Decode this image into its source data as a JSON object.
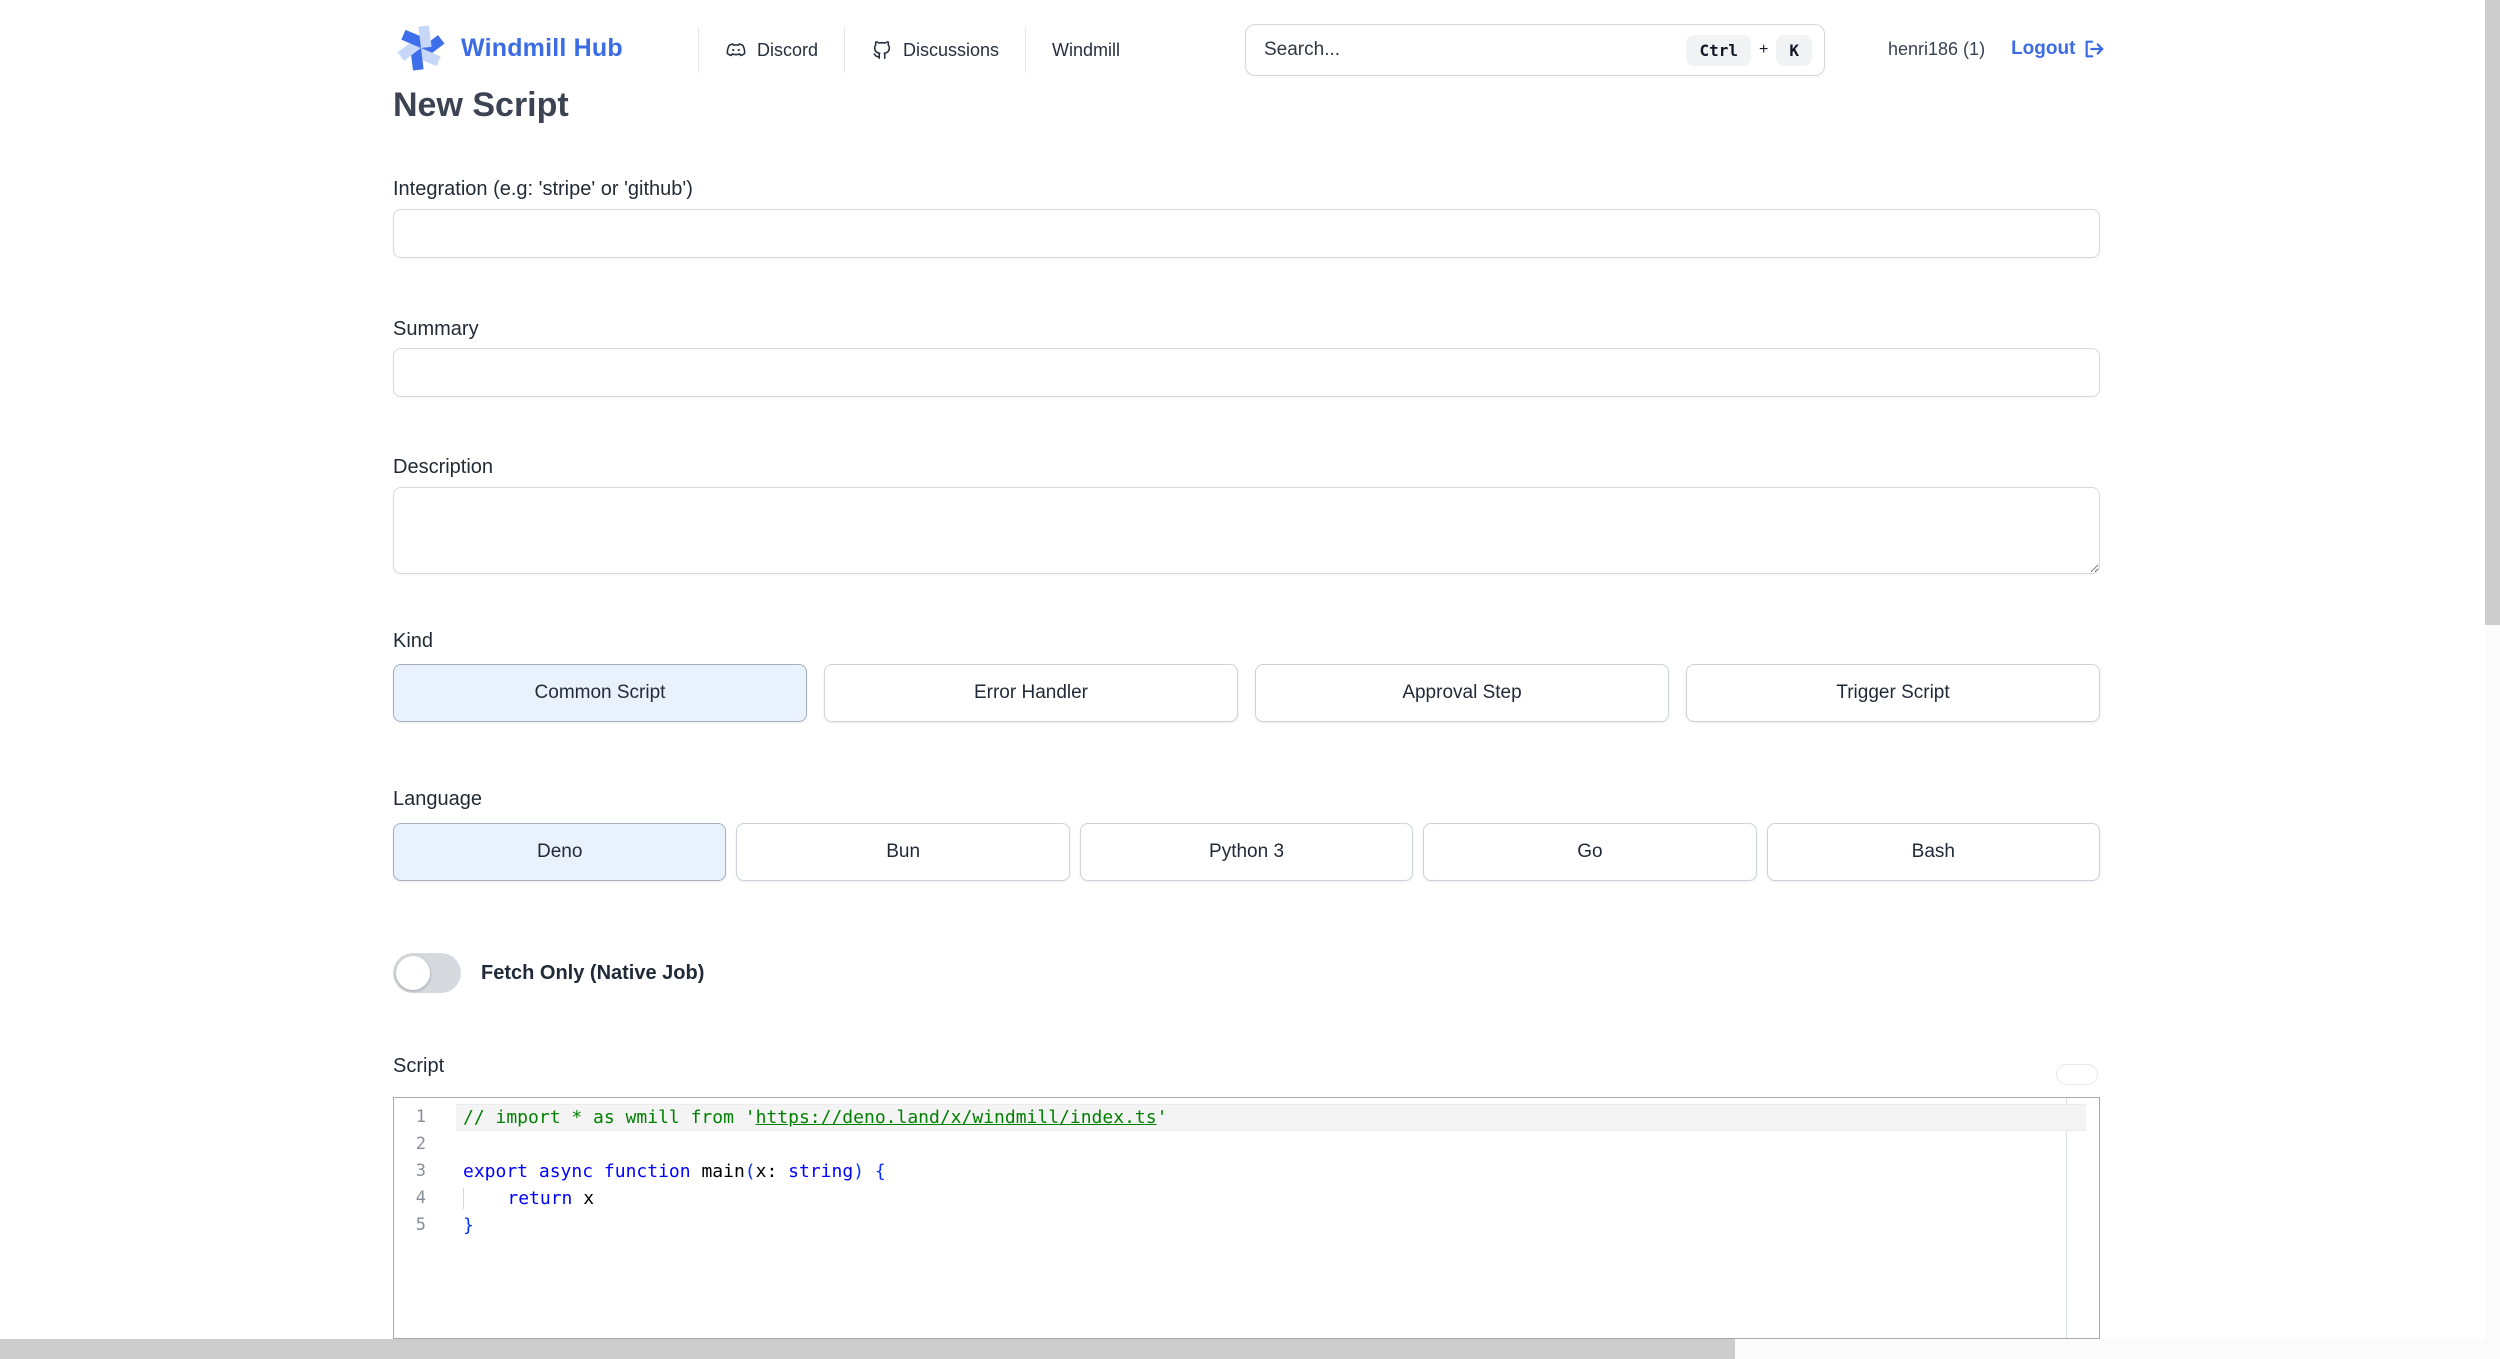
{
  "colors": {
    "brand_blue": "#3b6ce4",
    "selected_option_bg": "#e9f1fc",
    "code_comment_green": "#008000",
    "code_keyword_blue": "#0000ff",
    "scrollbar_gray": "#cdcdcd"
  },
  "header": {
    "brand": "Windmill Hub",
    "logo_icon": "windmill-pinwheel-icon",
    "nav": [
      {
        "label": "Discord",
        "icon": "discord-icon"
      },
      {
        "label": "Discussions",
        "icon": "github-icon"
      },
      {
        "label": "Windmill",
        "icon": "none"
      }
    ],
    "search": {
      "placeholder": "Search...",
      "shortcut_keys": [
        "Ctrl",
        "K"
      ],
      "shortcut_separator": "+"
    },
    "user": {
      "name": "henri186 (1)",
      "logout_label": "Logout",
      "logout_icon": "logout-icon"
    }
  },
  "page": {
    "title": "New Script"
  },
  "form": {
    "integration": {
      "label": "Integration (e.g: 'stripe' or 'github')",
      "value": ""
    },
    "summary": {
      "label": "Summary",
      "value": ""
    },
    "description": {
      "label": "Description",
      "value": ""
    },
    "kind": {
      "label": "Kind",
      "options": [
        "Common Script",
        "Error Handler",
        "Approval Step",
        "Trigger Script"
      ],
      "selected": "Common Script"
    },
    "language": {
      "label": "Language",
      "options": [
        "Deno",
        "Bun",
        "Python 3",
        "Go",
        "Bash"
      ],
      "selected": "Deno"
    },
    "fetch_only": {
      "label": "Fetch Only (Native Job)",
      "enabled": false
    },
    "script": {
      "label": "Script"
    }
  },
  "editor": {
    "lines": [
      {
        "num": "1",
        "current": true,
        "tokens": [
          {
            "t": "// import * as wmill from '",
            "c": "comment"
          },
          {
            "t": "https://deno.land/x/windmill/index.ts",
            "c": "comment-link"
          },
          {
            "t": "'",
            "c": "comment"
          }
        ]
      },
      {
        "num": "2",
        "current": false,
        "tokens": []
      },
      {
        "num": "3",
        "current": false,
        "tokens": [
          {
            "t": "export",
            "c": "kw"
          },
          {
            "t": " ",
            "c": "plain"
          },
          {
            "t": "async",
            "c": "kw"
          },
          {
            "t": " ",
            "c": "plain"
          },
          {
            "t": "function",
            "c": "kw"
          },
          {
            "t": " main",
            "c": "plain"
          },
          {
            "t": "(",
            "c": "bracket"
          },
          {
            "t": "x: ",
            "c": "plain"
          },
          {
            "t": "string",
            "c": "kw"
          },
          {
            "t": ")",
            "c": "bracket"
          },
          {
            "t": " ",
            "c": "plain"
          },
          {
            "t": "{",
            "c": "bracket"
          }
        ]
      },
      {
        "num": "4",
        "current": false,
        "tokens": [
          {
            "t": "    ",
            "c": "indent"
          },
          {
            "t": "return",
            "c": "kw"
          },
          {
            "t": " x",
            "c": "plain"
          }
        ]
      },
      {
        "num": "5",
        "current": false,
        "tokens": [
          {
            "t": "}",
            "c": "bracket"
          }
        ]
      }
    ]
  }
}
